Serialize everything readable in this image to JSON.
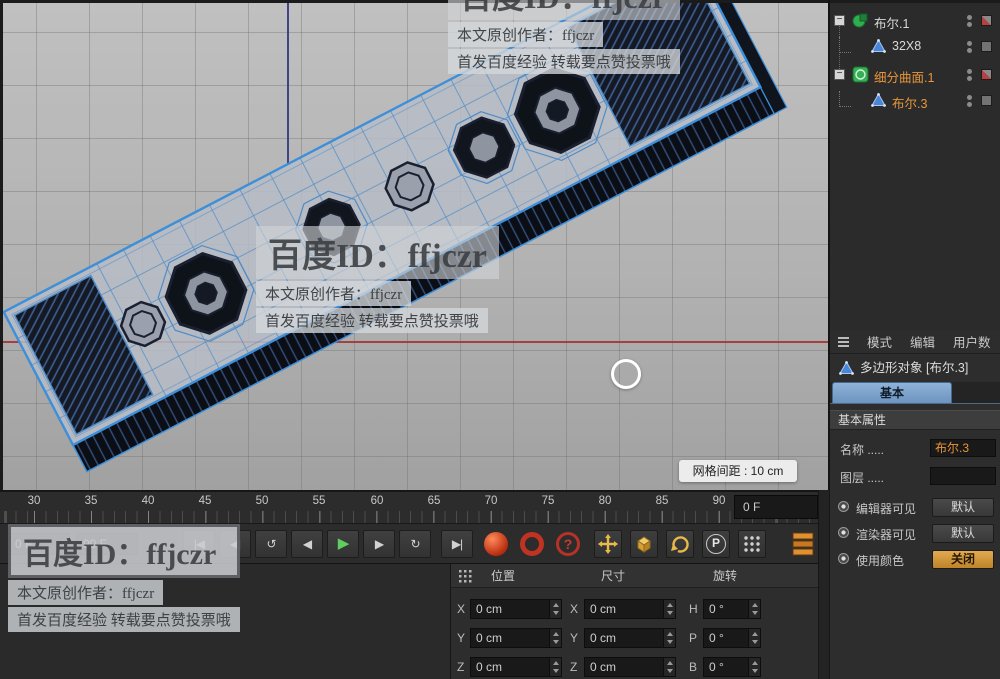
{
  "viewport": {
    "grid_spacing_label": "网格间距 : 10 cm"
  },
  "watermarks": {
    "top": {
      "big": "百度ID：ffjczr",
      "line1": "本文原创作者：ffjczr",
      "line2": "首发百度经验 转载要点赞投票哦"
    },
    "mid": {
      "big": "百度ID：ffjczr",
      "line1": "本文原创作者：ffjczr",
      "line2": "首发百度经验 转载要点赞投票哦"
    },
    "bottom": {
      "big": "百度ID：ffjczr",
      "line1": "本文原创作者：ffjczr",
      "line2": "首发百度经验 转载要点赞投票哦"
    }
  },
  "object_manager": {
    "expand_glyph": "−",
    "items": [
      {
        "label": "布尔.1"
      },
      {
        "label": "32X8"
      },
      {
        "label": "细分曲面.1"
      },
      {
        "label": "布尔.3"
      }
    ]
  },
  "timeline": {
    "ticks": [
      "30",
      "35",
      "40",
      "45",
      "50",
      "55",
      "60",
      "65",
      "70",
      "75",
      "80",
      "85",
      "90"
    ],
    "current_frame": "0 F",
    "range_start": "0 F",
    "range_end": "90 F"
  },
  "transport": {
    "buttons": [
      {
        "name": "goto-start-button",
        "glyph": "|◀"
      },
      {
        "name": "prev-key-button",
        "glyph": "◀|"
      },
      {
        "name": "play-reverse-button",
        "glyph": "↺"
      },
      {
        "name": "prev-frame-button",
        "glyph": "◀"
      },
      {
        "name": "play-button",
        "glyph": "▶"
      },
      {
        "name": "next-frame-button",
        "glyph": "▶"
      },
      {
        "name": "loop-button",
        "glyph": "↻"
      },
      {
        "name": "goto-end-button",
        "glyph": "▶|"
      }
    ],
    "help_glyph": "?",
    "p_label": "P"
  },
  "coords": {
    "headers": [
      "位置",
      "尺寸",
      "旋转"
    ],
    "rows": [
      {
        "axis": "X",
        "pos": "0 cm",
        "size": "0 cm",
        "rot_axis": "H",
        "rot": "0 °"
      },
      {
        "axis": "Y",
        "pos": "0 cm",
        "size": "0 cm",
        "rot_axis": "P",
        "rot": "0 °"
      },
      {
        "axis": "Z",
        "pos": "0 cm",
        "size": "0 cm",
        "rot_axis": "B",
        "rot": "0 °"
      }
    ]
  },
  "attributes": {
    "tabs": [
      {
        "label": "模式"
      },
      {
        "label": "编辑"
      },
      {
        "label": "用户数"
      }
    ],
    "object_title": "多边形对象 [布尔.3]",
    "basic_tab_label": "基本",
    "section_title": "基本属性",
    "name_label": "名称 .....",
    "name_value": "布尔.3",
    "layer_label": "图层 .....",
    "toggles": [
      {
        "label": "编辑器可见",
        "value": "默认"
      },
      {
        "label": "渲染器可见",
        "value": "默认"
      },
      {
        "label": "使用颜色",
        "value": "关闭"
      }
    ]
  },
  "colors": {
    "accent_orange": "#e8953a",
    "selection_blue": "#3d8fd9",
    "play_green": "#5ecf5e",
    "record_red": "#c23222"
  }
}
